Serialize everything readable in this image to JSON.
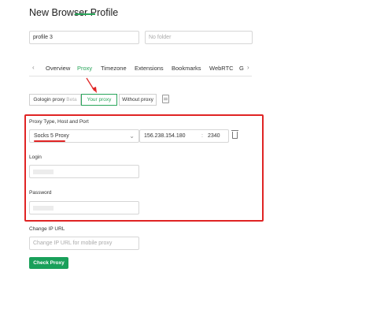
{
  "page": {
    "title": "New Browser Profile"
  },
  "profile": {
    "name_value": "profile 3",
    "folder_placeholder": "No folder"
  },
  "tabs": {
    "items": [
      {
        "label": "Overview"
      },
      {
        "label": "Proxy"
      },
      {
        "label": "Timezone"
      },
      {
        "label": "Extensions"
      },
      {
        "label": "Bookmarks"
      },
      {
        "label": "WebRTC"
      },
      {
        "label": "G"
      }
    ],
    "active": "Proxy",
    "prev_glyph": "‹",
    "next_glyph": "›"
  },
  "proxy_source": {
    "gologin_label": "Gologin proxy",
    "gologin_tag": "Beta",
    "your_proxy_label": "Your proxy",
    "without_proxy_label": "Without proxy",
    "selected": "Your proxy"
  },
  "proxy_settings": {
    "section_label": "Proxy Type, Host and Port",
    "type_value": "Socks 5 Proxy",
    "host_value": "156.238.154.180",
    "port_separator": ":",
    "port_value": "2340",
    "login_label": "Login",
    "password_label": "Password"
  },
  "change_ip": {
    "label": "Change IP URL",
    "placeholder": "Change IP URL for mobile proxy"
  },
  "actions": {
    "check_proxy_label": "Check Proxy"
  },
  "icons": {
    "trash": "trash-icon",
    "notes": "notes-icon",
    "arrow": "red-arrow-annotation"
  },
  "colors": {
    "accent": "#2aa55b",
    "button": "#19a05a",
    "highlight": "#e02424"
  }
}
